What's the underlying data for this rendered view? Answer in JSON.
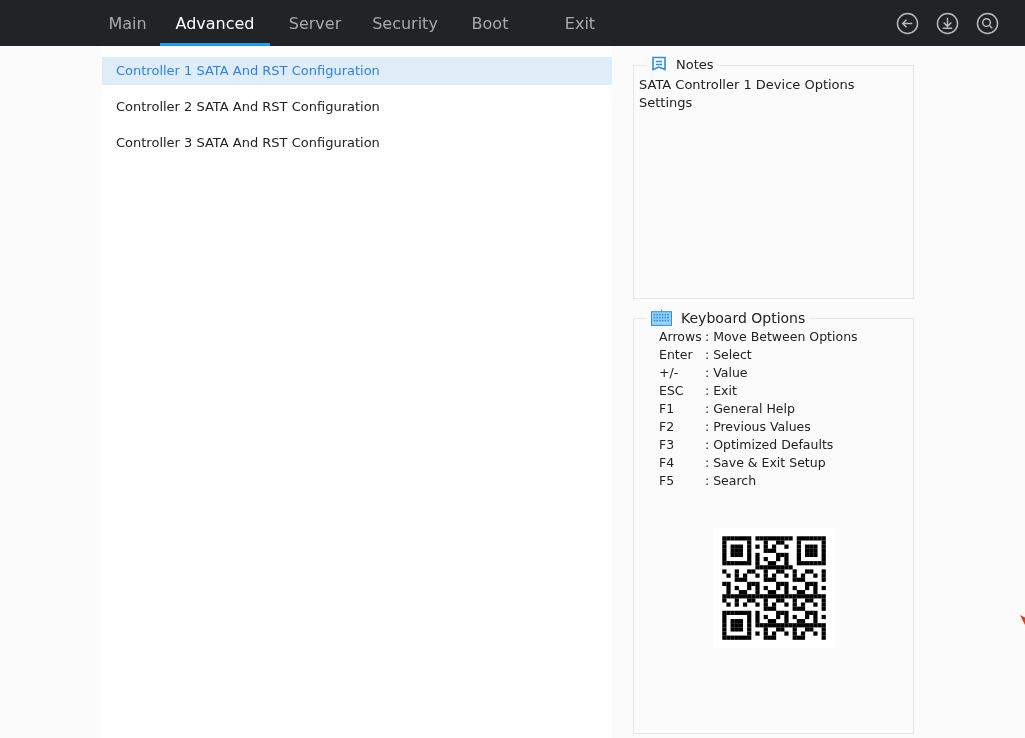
{
  "tabs": [
    {
      "label": "Main",
      "selected": false
    },
    {
      "label": "Advanced",
      "selected": true
    },
    {
      "label": "Server",
      "selected": false
    },
    {
      "label": "Security",
      "selected": false
    },
    {
      "label": "Boot",
      "selected": false
    },
    {
      "label": "Exit",
      "selected": false
    }
  ],
  "menu": [
    {
      "label": "Controller 1 SATA And RST Configuration",
      "selected": true
    },
    {
      "label": "Controller 2 SATA And RST Configuration",
      "selected": false
    },
    {
      "label": "Controller 3 SATA And RST Configuration",
      "selected": false
    }
  ],
  "notes": {
    "title": "Notes",
    "text": "SATA Controller 1 Device Options Settings"
  },
  "keyboard_options": {
    "title": "Keyboard Options",
    "items": [
      {
        "key": "Arrows",
        "action": ": Move Between Options"
      },
      {
        "key": "Enter",
        "action": ": Select"
      },
      {
        "key": "+/-",
        "action": ": Value"
      },
      {
        "key": "ESC",
        "action": ": Exit"
      },
      {
        "key": "F1",
        "action": ": General Help"
      },
      {
        "key": "F2",
        "action": ": Previous Values"
      },
      {
        "key": "F3",
        "action": ": Optimized Defaults"
      },
      {
        "key": "F4",
        "action": ": Save & Exit Setup"
      },
      {
        "key": "F5",
        "action": ": Search"
      }
    ]
  }
}
